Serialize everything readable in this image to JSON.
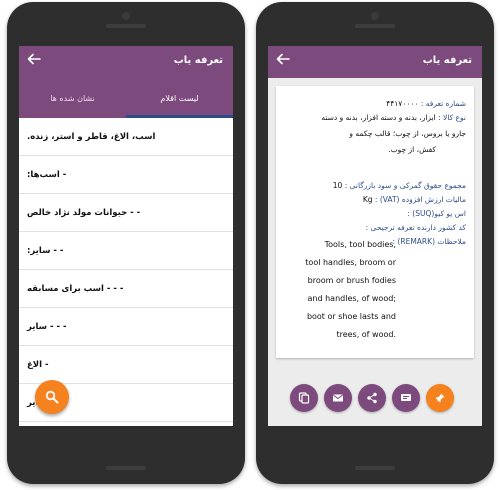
{
  "left": {
    "appbar": {
      "title": "تعرفه یاب"
    },
    "tabs": [
      {
        "label": "لیست اقلام",
        "active": true
      },
      {
        "label": "نشان شده ها",
        "active": false
      }
    ],
    "items": [
      "اسب، الاغ، قاطر و استر، زنده.",
      "- اسب‌ها:",
      "- - حیوانات مولد نژاد خالص",
      "- - سایر:",
      "- - - اسب برای مسابقه",
      "- - - سایر",
      "- الاغ",
      "- سایر"
    ],
    "fab_icon": "search-icon"
  },
  "right": {
    "appbar": {
      "title": "تعرفه یاب"
    },
    "tariff_label": "شماره تعرفه :",
    "tariff_value": "۴۴۱۷۰۰۰۰",
    "goods_label": "نوع کالا :",
    "goods_value_1": "ابزار، بدنه و دسته افزار، بدنه و دسته",
    "goods_value_2": "جارو یا بروس، از چوب؛ قالب چکمه و",
    "goods_value_3": "کفش، از چوب.",
    "duty_label": "مجموع حقوق گمرکی و سود بازرگانی :",
    "duty_value": "10",
    "vat_label": "مالیات ارزش افزوده (VAT) :",
    "vat_value": "Kg",
    "suq_label": "اس یو کیو(SUQ) :",
    "pref_label": "کد کشور دارنده تعرفه ترجیحی :",
    "remark_label": "ملاحظات (REMARK) :",
    "english": [
      "Tools, tool bodies,",
      "tool handles, broom or",
      "broom or brush fodies",
      "and handles, of wood;",
      "boot or shoe lasts and",
      "trees, of wood."
    ],
    "actions": [
      "copy-icon",
      "email-icon",
      "share-icon",
      "message-icon",
      "pin-icon"
    ]
  },
  "colors": {
    "primary": "#7c4a7c",
    "accent": "#f5821f",
    "label": "#2d4d8a"
  }
}
